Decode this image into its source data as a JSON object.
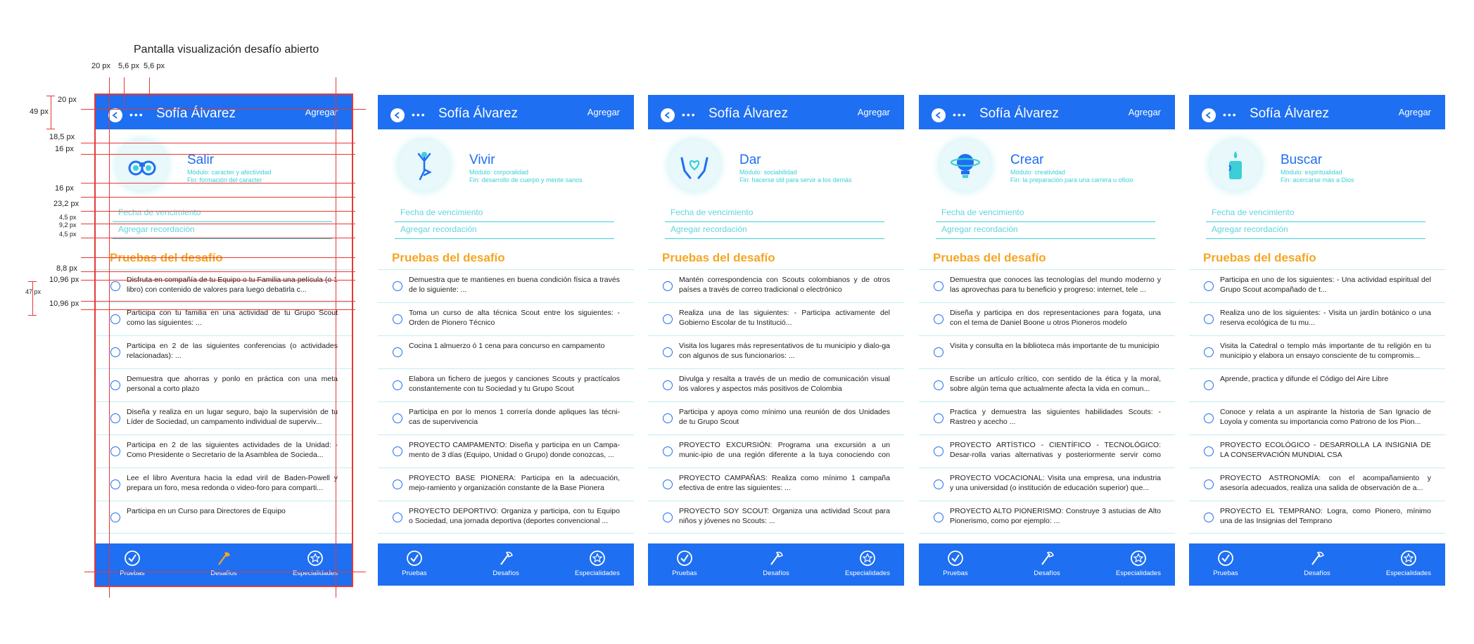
{
  "spec": {
    "title": "Pantalla visualización desafío abierto",
    "top_dims": [
      "20 px",
      "5,6 px",
      "5,6 px"
    ],
    "side_dims": [
      "20 px",
      "49 px",
      "18,5 px",
      "16 px",
      "16 px",
      "23,2 px",
      "4,5 px",
      "9,2 px",
      "4,5 px",
      "8,8 px",
      "10,96 px",
      "47 px",
      "10,96 px"
    ]
  },
  "common": {
    "user_name": "Sofía Álvarez",
    "add_label": "Agregar",
    "dots": "•••",
    "due_placeholder": "Fecha de vencimiento",
    "reminder_placeholder": "Agregar recordación",
    "section_title": "Pruebas del desafío",
    "nav": [
      "Pruebas",
      "Desafíos",
      "Especialidades"
    ]
  },
  "colors": {
    "primary": "#1e6ff1",
    "accent_cyan": "#3ccfd8",
    "section_orange": "#f4a623",
    "annotation_red": "#e53935"
  },
  "screens": [
    {
      "title": "Salir",
      "icon": "binoculars-icon",
      "module": "Módulo: caracter y afectividad",
      "goal": "Fin: formación del caracter",
      "tests": [
        "Disfruta en compañía de tu Equipo o tu Familia una película (o 1 libro) con contenido de valores para luego debatirla c...",
        "Participa con tu familia en una actividad de tu Grupo Scout como las siguientes: ...",
        "Participa en 2 de las siguientes conferencias (o actividades relacionadas): ...",
        "Demuestra que ahorras y ponlo en práctica con una meta personal a corto plazo",
        "Diseña y realiza en un lugar seguro, bajo la supervisión de tu Líder de Sociedad, un campamento individual de superviv...",
        "Participa en 2 de las siguientes actividades de la Unidad: - Como Presidente o Secretario de la Asamblea de Socieda...",
        "Lee el libro Aventura hacia la edad viril de Baden-Powell y prepara un foro, mesa redonda o video-foro para comparti...",
        "Participa en un Curso para Directores de Equipo"
      ]
    },
    {
      "title": "Vivir",
      "icon": "yoga-pose-icon",
      "module": "Módulo: corporalidad",
      "goal": "Fin: desarrollo de cuerpo y mente sanos",
      "tests": [
        "Demuestra que te mantienes en buena condición física a través de lo siguiente: ...",
        "Toma un curso de alta técnica Scout entre los siguientes: - Orden de Pionero Técnico",
        "Cocina 1 almuerzo ó 1 cena para concurso en campamento",
        "Elabora un fichero de juegos y canciones Scouts y practícalos constantemente con tu Sociedad y tu Grupo Scout",
        "Participa en por lo menos 1 correría donde apliques las técni-cas de supervivencia",
        "PROYECTO CAMPAMENTO: Diseña y participa en un Campa-mento de 3 días (Equipo, Unidad o Grupo) donde conozcas, ...",
        "PROYECTO BASE PIONERA: Participa en la adecuación, mejo-ramiento y organización constante de la Base Pionera",
        "PROYECTO DEPORTIVO: Organiza y participa, con tu Equipo o Sociedad, una jornada deportiva (deportes convencional ..."
      ]
    },
    {
      "title": "Dar",
      "icon": "hands-heart-icon",
      "module": "Módulo: sociabilidad",
      "goal": "Fin: hacerse útil para servir a los demás",
      "tests": [
        "Mantén correspondencia con Scouts colombianos y de otros países a través de correo tradicional o electrónico",
        "Realiza una de las siguientes: - Participa activamente del Gobierno Escolar de tu Institució...",
        "Visita los lugares más representativos de tu municipio y dialo-ga con algunos de sus funcionarios: ...",
        "Divulga y resalta a través de un medio de comunicación visual los valores y aspectos más positivos de Colombia",
        "Participa y apoya como mínimo una reunión de dos Unidades de tu Grupo Scout",
        "PROYECTO EXCURSIÓN: Programa una excursión a un munic-ipio de una región diferente a la tuya conociendo con anticip...",
        "PROYECTO CAMPAÑAS: Realiza como mínimo 1 campaña efectiva de entre las siguientes: ...",
        "PROYECTO SOY SCOUT: Organiza una actividad Scout para niños y jóvenes no Scouts: ..."
      ]
    },
    {
      "title": "Crear",
      "icon": "lightbulb-planet-icon",
      "module": "Módulo: creatividad",
      "goal": "Fin: la preparación para una carrera u oficio",
      "tests": [
        "Demuestra que conoces las tecnologías del mundo moderno y las aprovechas para tu beneficio y progreso: internet, tele ...",
        "Diseña y participa en dos representaciones para fogata, una con el tema de Daniel Boone u otros Pioneros modelo",
        "Visita y consulta en la biblioteca más importante de tu municipio",
        "Escribe un artículo crítico, con sentido de la ética y la moral, sobre algún tema que actualmente afecta la vida en comun...",
        "Practica y demuestra las siguientes habilidades Scouts: - Rastreo y acecho ...",
        "PROYECTO ARTÍSTICO - CIENTÍFICO - TECNOLÓGICO: Desar-rolla varias alternativas y posteriormente servir como Sinod ...",
        "PROYECTO VOCACIONAL: Visita una empresa, una industria y una universidad (o institución de educación superior) que...",
        "PROYECTO ALTO PIONERISMO: Construye 3 astucias de Alto Pionerismo, como por ejemplo: ..."
      ]
    },
    {
      "title": "Buscar",
      "icon": "candle-icon",
      "module": "Módulo: espiritualidad",
      "goal": "Fin: acercarse más a Dios",
      "tests": [
        "Participa en uno de los siguientes: - Una actividad espiritual del Grupo Scout acompañado de t...",
        "Realiza uno de los siguientes: - Visita un jardín botánico o una reserva ecológica de tu mu...",
        "Visita la Catedral o templo más importante de tu religión en tu municipio y elabora un ensayo consciente de tu compromis...",
        "Aprende, practica y difunde el Código del Aire Libre",
        "Conoce y relata a un aspirante la historia de San Ignacio de Loyola y comenta su importancia como Patrono de los Pion...",
        "PROYECTO ECOLÓGICO - DESARROLLA LA INSIGNIA DE LA CONSERVACIÓN MUNDIAL CSA",
        "PROYECTO ASTRONOMÍA: con el acompañamiento y asesoría adecuados, realiza una salida de observación de a...",
        "PROYECTO EL TEMPRANO: Logra, como Pionero, mínimo una de las Insignias del Temprano"
      ]
    }
  ]
}
